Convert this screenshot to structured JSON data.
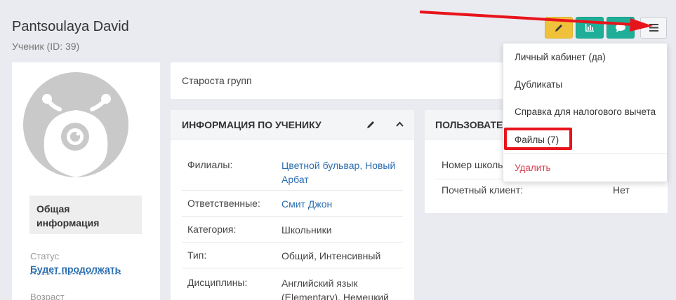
{
  "header": {
    "name": "Pantsoulaya David",
    "subtitle": "Ученик (ID: 39)"
  },
  "toolbar": {
    "edit_icon": "pencil-icon",
    "chart_icon": "bar-chart-icon",
    "chat_icon": "chat-bubble-icon",
    "menu_icon": "hamburger-menu-icon",
    "colors": {
      "edit": "#f0c23b",
      "teal": "#1fae98",
      "annotation": "#e8141c"
    }
  },
  "left_card": {
    "info_block": "Общая информация",
    "status_label": "Статус",
    "status_value": "Будет продолжать",
    "age_label": "Возраст"
  },
  "group_card": {
    "text": "Староста групп"
  },
  "student_panel": {
    "title": "ИНФОРМАЦИЯ ПО УЧЕНИКУ",
    "rows": [
      {
        "label": "Филиалы:",
        "value": "Цветной бульвар, Новый Арбат"
      },
      {
        "label": "Ответственные:",
        "value": "Смит Джон"
      },
      {
        "label": "Категория:",
        "value": "Школьники"
      },
      {
        "label": "Тип:",
        "value": "Общий, Интенсивный"
      },
      {
        "label": "Дисциплины:",
        "value": "Английский язык (Elementary), Немецкий"
      }
    ]
  },
  "user_panel": {
    "title": "ПОЛЬЗОВАТЕ",
    "rows": [
      {
        "label": "Номер школь",
        "value": ""
      },
      {
        "label": "Почетный клиент:",
        "value": "Нет"
      }
    ]
  },
  "dropdown": {
    "items": [
      {
        "label": "Личный кабинет (да)"
      },
      {
        "label": "Дубликаты"
      },
      {
        "label": "Справка для налогового вычета"
      },
      {
        "label": "Файлы (7)"
      },
      {
        "label": "Удалить"
      }
    ]
  }
}
